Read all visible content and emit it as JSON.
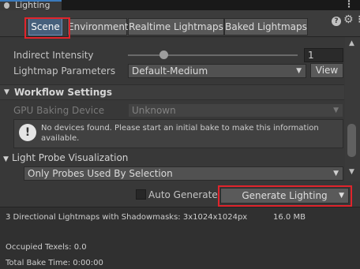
{
  "window": {
    "title": "Lighting"
  },
  "tabs": [
    {
      "label": "Scene"
    },
    {
      "label": "Environment"
    },
    {
      "label": "Realtime Lightmaps"
    },
    {
      "label": "Baked Lightmaps"
    }
  ],
  "indirect_intensity": {
    "label": "Indirect Intensity",
    "value": "1",
    "slider_fraction": 0.2
  },
  "lightmap_parameters": {
    "label": "Lightmap Parameters",
    "value": "Default-Medium",
    "view_label": "View"
  },
  "workflow": {
    "header": "Workflow Settings",
    "gpu_label": "GPU Baking Device",
    "gpu_value": "Unknown",
    "help_icon": "!",
    "help_text": "No devices found. Please start an initial bake to make this information available."
  },
  "probe": {
    "header": "Light Probe Visualization",
    "value": "Only Probes Used By Selection"
  },
  "bake": {
    "auto_label": "Auto Generate",
    "auto_checked": false,
    "generate_label": "Generate Lighting"
  },
  "stats": {
    "lightmaps": "3 Directional Lightmaps with Shadowmasks: 3x1024x1024px",
    "size": "16.0 MB",
    "texels": "Occupied Texels: 0.0",
    "bake_time": "Total Bake Time: 0:00:00"
  },
  "icons": {
    "window": "lighting-bulb-icon",
    "help": "help-icon",
    "settings": "gear-icon",
    "menu": "kebab-menu-icon"
  },
  "colors": {
    "highlight": "#e0242c",
    "active_tab": "#46607c"
  }
}
